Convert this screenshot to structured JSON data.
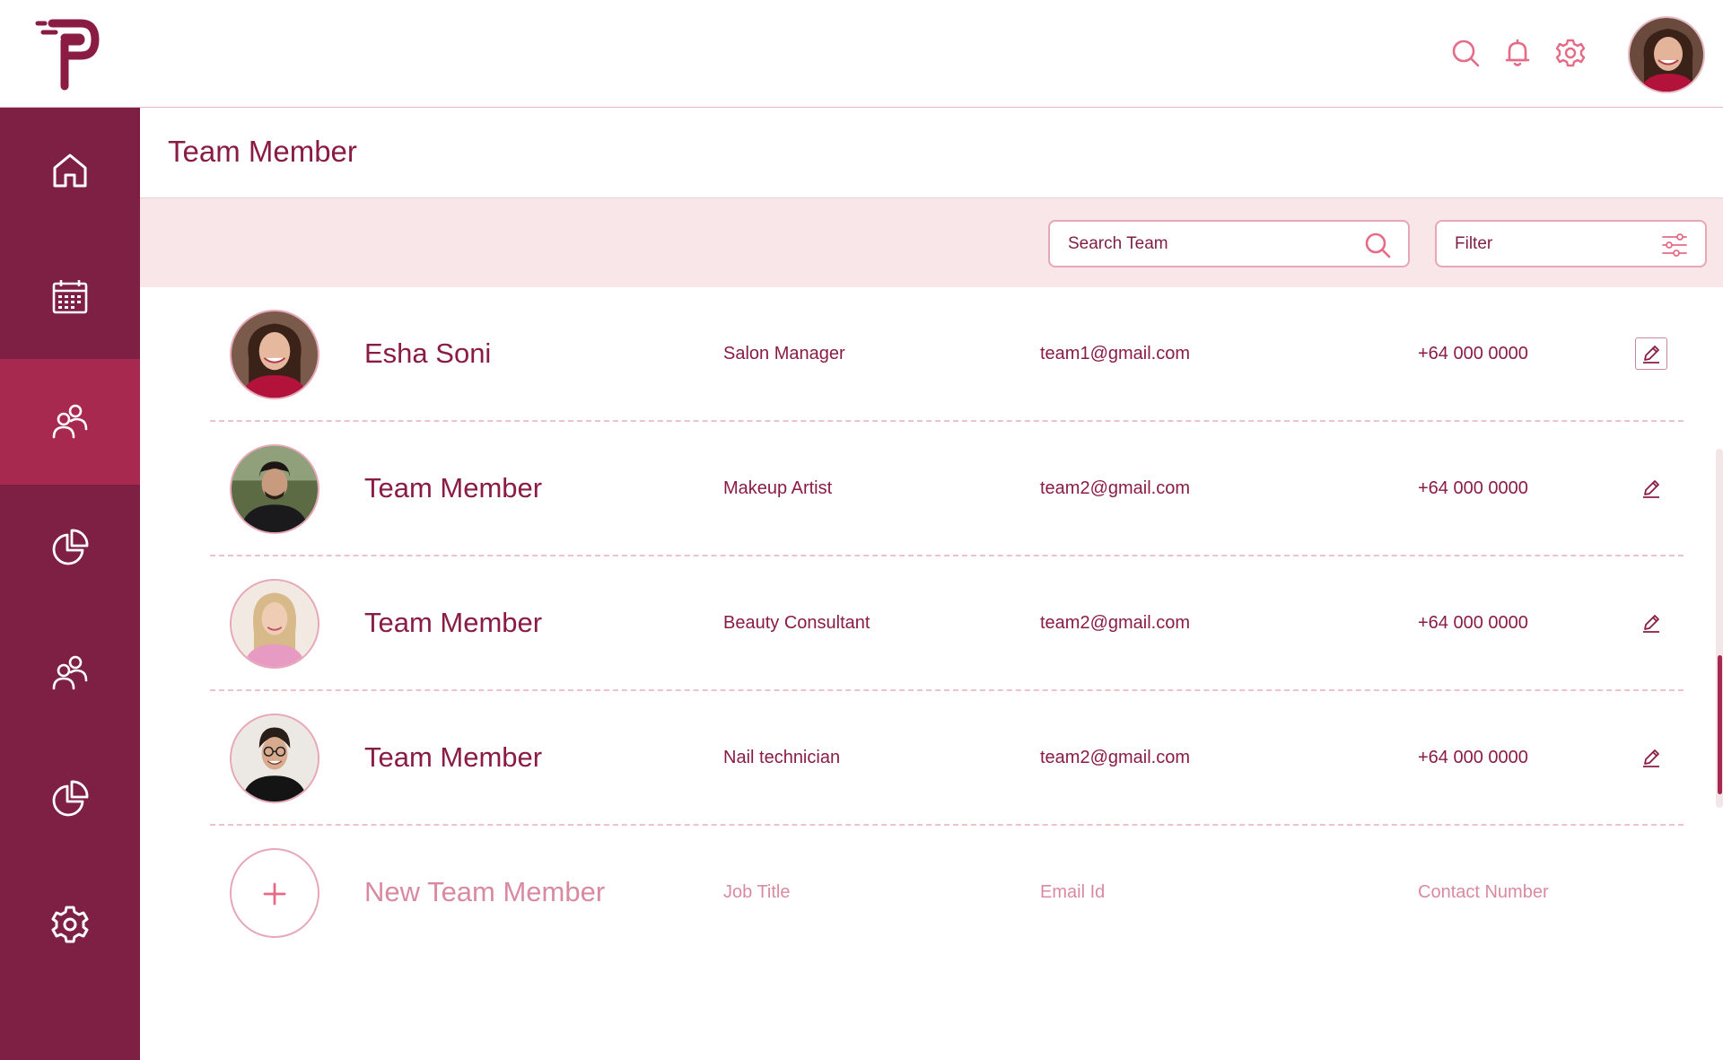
{
  "header": {
    "title": "Team Member"
  },
  "toolbar": {
    "search_label": "Search Team",
    "filter_label": "Filter"
  },
  "theme": {
    "sidebar": "#7e1f44",
    "sidebar_active": "#a8294f",
    "accent": "#e56b87",
    "text": "#8a1c44",
    "toolbar_bg": "#f9e6e8"
  },
  "top_icons": [
    "search-icon",
    "bell-icon",
    "gear-icon"
  ],
  "sidebar": {
    "items": [
      {
        "icon": "home-icon",
        "active": false
      },
      {
        "icon": "calendar-icon",
        "active": false
      },
      {
        "icon": "users-icon",
        "active": true
      },
      {
        "icon": "pie-chart-icon",
        "active": false
      },
      {
        "icon": "users-icon",
        "active": false
      },
      {
        "icon": "pie-chart-icon",
        "active": false
      },
      {
        "icon": "gear-icon",
        "active": false
      }
    ]
  },
  "team": [
    {
      "name": "Esha Soni",
      "job": "Salon Manager",
      "email": "team1@gmail.com",
      "phone": "+64 000 0000"
    },
    {
      "name": "Team Member",
      "job": "Makeup Artist",
      "email": "team2@gmail.com",
      "phone": "+64 000 0000"
    },
    {
      "name": "Team Member",
      "job": "Beauty Consultant",
      "email": "team2@gmail.com",
      "phone": "+64 000 0000"
    },
    {
      "name": "Team Member",
      "job": "Nail technician",
      "email": "team2@gmail.com",
      "phone": "+64 000 0000"
    }
  ],
  "new_member": {
    "name": "New Team Member",
    "job": "Job Title",
    "email": "Email Id",
    "phone": "Contact Number"
  }
}
